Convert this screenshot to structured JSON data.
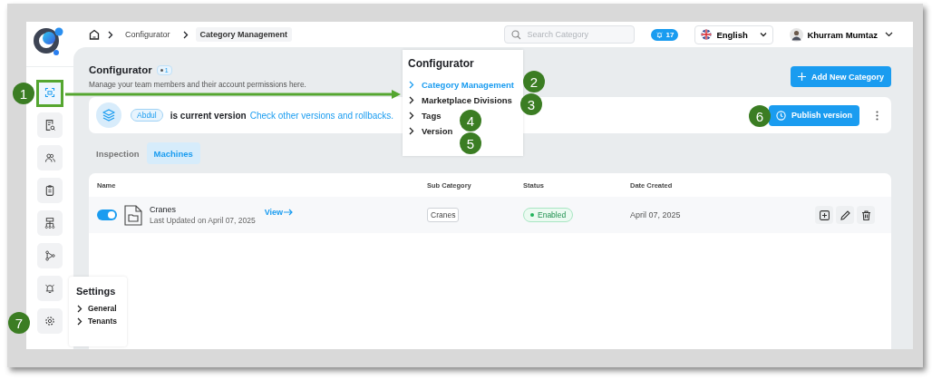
{
  "breadcrumb": [
    {
      "label": "Configurator",
      "current": false
    },
    {
      "label": "Category Management",
      "current": true
    }
  ],
  "search": {
    "placeholder": "Search Category"
  },
  "notifications": {
    "count": "17"
  },
  "language": {
    "value": "English"
  },
  "user": {
    "name": "Khurram Mumtaz"
  },
  "sidebar": {
    "items": [
      {
        "kind": "category",
        "selected": true
      },
      {
        "kind": "document",
        "selected": false
      },
      {
        "kind": "users",
        "selected": false
      },
      {
        "kind": "clipboard",
        "selected": false
      },
      {
        "kind": "hierarchy",
        "selected": false
      },
      {
        "kind": "nodes",
        "selected": false
      },
      {
        "kind": "bell",
        "selected": false
      },
      {
        "kind": "settings",
        "selected": false
      }
    ]
  },
  "page": {
    "title": "Configurator",
    "badge": "1",
    "subtitle": "Manage your team members and their account permissions here.",
    "add_button": "Add New Category"
  },
  "version_banner": {
    "version": "Abdul",
    "status": "is current version",
    "link": "Check other versions and rollbacks.",
    "publish_button": "Publish version"
  },
  "tabs": [
    {
      "label": "Inspection",
      "selected": false
    },
    {
      "label": "Machines",
      "selected": true
    }
  ],
  "table": {
    "columns": [
      "Name",
      "Sub Category",
      "Status",
      "Date Created"
    ],
    "rows": [
      {
        "on": true,
        "name": "Cranes",
        "updated": "Last Updated on April 07, 2025",
        "link": "View",
        "sub_category": "Cranes",
        "status": "Enabled",
        "date": "April 07, 2025"
      }
    ]
  },
  "configurator_menu": {
    "title": "Configurator",
    "items": [
      {
        "label": "Category Management",
        "selected": true
      },
      {
        "label": "Marketplace Divisions",
        "selected": false
      },
      {
        "label": "Tags",
        "selected": false
      },
      {
        "label": "Version",
        "selected": false
      }
    ]
  },
  "settings_menu": {
    "title": "Settings",
    "items": [
      {
        "label": "General"
      },
      {
        "label": "Tenants"
      }
    ]
  },
  "annotations": [
    {
      "label": "1"
    },
    {
      "label": "2"
    },
    {
      "label": "3"
    },
    {
      "label": "4"
    },
    {
      "label": "5"
    },
    {
      "label": "6"
    },
    {
      "label": "7"
    }
  ]
}
